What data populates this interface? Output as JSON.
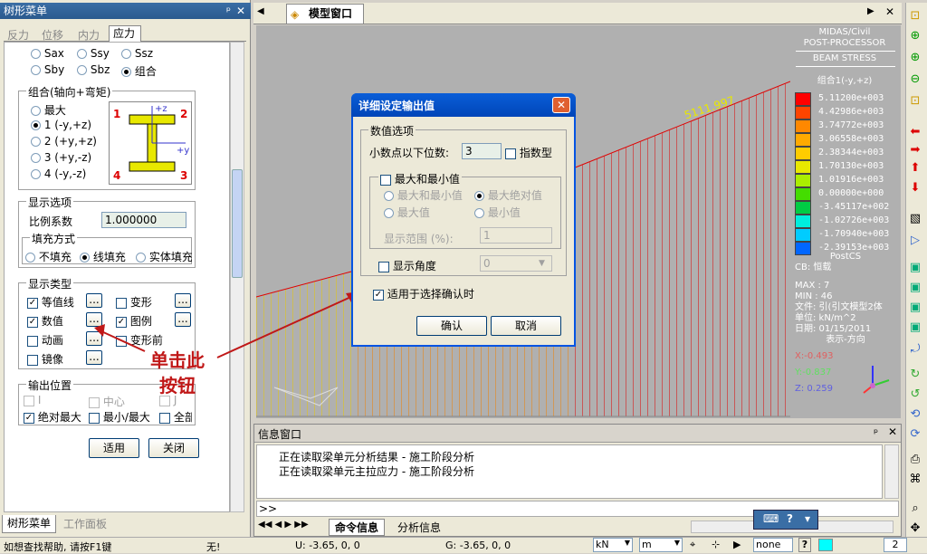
{
  "tree_panel": {
    "title": "树形菜单",
    "tabs": [
      "反力",
      "位移",
      "内力",
      "应力"
    ],
    "active_tab": "应力",
    "stress_opts": [
      "Sax",
      "Ssy",
      "Ssz",
      "Sby",
      "Sbz",
      "组合"
    ],
    "combo_group": "组合(轴向+弯矩)",
    "combo_opts": [
      "最大",
      "1 (-y,+z)",
      "2 (+y,+z)",
      "3 (+y,-z)",
      "4 (-y,-z)"
    ],
    "section_labels": [
      "1",
      "2",
      "3",
      "4"
    ],
    "axis_z": "+z",
    "axis_y": "+y",
    "display_opts": "显示选项",
    "scale_label": "比例系数",
    "scale_value": "1.000000",
    "fill_title": "填充方式",
    "fill_opts": [
      "不填充",
      "线填充",
      "实体填充"
    ],
    "display_type": "显示类型",
    "types_left": [
      "等值线",
      "数值",
      "动画",
      "镜像"
    ],
    "types_right": [
      "变形",
      "图例",
      "变形前"
    ],
    "more_btn": "...",
    "output_pos": "输出位置",
    "pos_row1": [
      "I",
      "中心",
      "J"
    ],
    "pos_row2": [
      "绝对最大",
      "最小/最大",
      "全部"
    ],
    "apply_btn": "适用",
    "close_btn": "关闭",
    "bottom_tabs": [
      "树形菜单",
      "工作面板"
    ]
  },
  "model_window": {
    "tab": "模型窗口",
    "peak_value": "5111.997",
    "legend": {
      "header1": "MIDAS/Civil",
      "header2": "POST-PROCESSOR",
      "header3": "BEAM STRESS",
      "combo": "组合1(-y,+z)",
      "values": [
        "5.11200e+003",
        "4.42986e+003",
        "3.74772e+003",
        "3.06558e+003",
        "2.38344e+003",
        "1.70130e+003",
        "1.01916e+003",
        "0.00000e+000",
        "-3.45117e+002",
        "-1.02726e+003",
        "-1.70940e+003",
        "-2.39153e+003"
      ],
      "colors": [
        "#ff0000",
        "#ff4400",
        "#ff8800",
        "#ffaa00",
        "#ffcc00",
        "#e8e800",
        "#aaee00",
        "#44dd00",
        "#00cc44",
        "#00eedd",
        "#00ccff",
        "#0066ff"
      ],
      "cs": "PostCS",
      "cb": "CB: 恒载",
      "max": "MAX : 7",
      "min": "MIN : 46",
      "file": "文件: 引(引文模型2体",
      "unit": "单位: kN/m^2",
      "date": "日期: 01/15/2011",
      "view": "表示-方向",
      "x": "X:-0.493",
      "y": "Y:-0.837",
      "z": "Z: 0.259"
    }
  },
  "dialog": {
    "title": "详细设定输出值",
    "group": "数值选项",
    "decimal_label": "小数点以下位数:",
    "decimal_value": "3",
    "exp_label": "指数型",
    "maxmin": "最大和最小值",
    "r1": "最大和最小值",
    "r2": "最大绝对值",
    "r3": "最大值",
    "r4": "最小值",
    "range_label": "显示范围 (%):",
    "range_value": "1",
    "angle_label": "显示角度",
    "angle_value": "0",
    "apply_sel": "适用于选择确认时",
    "ok": "确认",
    "cancel": "取消"
  },
  "annotation": {
    "line1": "单击此",
    "line2": "按钮"
  },
  "info_window": {
    "title": "信息窗口",
    "lines": [
      "正在读取梁单元分析结果 - 施工阶段分析",
      "正在读取梁单元主拉应力 - 施工阶段分析"
    ],
    "prompt": ">>",
    "tabs": [
      "命令信息",
      "分析信息"
    ]
  },
  "status": {
    "help": "如想查找帮助, 请按F1键",
    "none": "无!",
    "u": "U: -3.65, 0, 0",
    "g": "G: -3.65, 0, 0",
    "force": "kN",
    "length": "m",
    "none2": "none",
    "q": "?",
    "page": "2"
  }
}
